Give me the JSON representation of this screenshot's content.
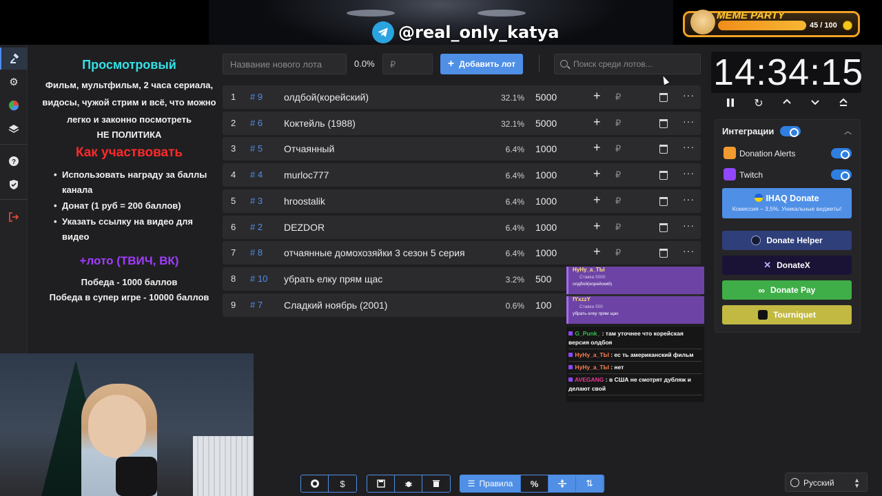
{
  "banner": {
    "handle": "@real_only_katya",
    "meme_title": "MEME PARTY",
    "meme_count": "45 / 100",
    "meme_progress": 0.45
  },
  "rail": {
    "items": [
      "auction-icon",
      "gear-icon",
      "stats-icon",
      "layers-icon",
      "help-icon",
      "shield-icon",
      "logout-icon"
    ]
  },
  "info": {
    "title": "Просмотровый",
    "description": "Фильм, мультфильм, 2 часа сериала, видосы, чужой стрим и всё, что можно легко и законно посмотреть",
    "no_politics": "НЕ ПОЛИТИКА",
    "how_title": "Как участвовать",
    "how_items": [
      "Использовать награду за баллы канала",
      "Донат (1 руб = 200 баллов)",
      "Указать ссылку на видео для видео"
    ],
    "loto": "+лото (ТВИЧ, ВК)",
    "win1": "Победа - 1000 баллов",
    "win2": "Победа в супер игре - 10000 баллов"
  },
  "controls": {
    "name_placeholder": "Название нового лота",
    "percent": "0.0%",
    "amount_placeholder": "₽",
    "add_label": "Добавить лот",
    "search_placeholder": "Поиск среди лотов..."
  },
  "lots": [
    {
      "index": "1",
      "id": "# 9",
      "name": "олдбой(корейский)",
      "percent": "32.1%",
      "amount": "5000"
    },
    {
      "index": "2",
      "id": "# 6",
      "name": "Коктейль (1988)",
      "percent": "32.1%",
      "amount": "5000"
    },
    {
      "index": "3",
      "id": "# 5",
      "name": "Отчаянный",
      "percent": "6.4%",
      "amount": "1000"
    },
    {
      "index": "4",
      "id": "# 4",
      "name": "murloc777",
      "percent": "6.4%",
      "amount": "1000"
    },
    {
      "index": "5",
      "id": "# 3",
      "name": "hroostalik",
      "percent": "6.4%",
      "amount": "1000"
    },
    {
      "index": "6",
      "id": "# 2",
      "name": "DEZDOR",
      "percent": "6.4%",
      "amount": "1000"
    },
    {
      "index": "7",
      "id": "# 8",
      "name": "отчаянные домохозяйки 3 сезон 5 серия",
      "percent": "6.4%",
      "amount": "1000"
    },
    {
      "index": "8",
      "id": "# 10",
      "name": "убрать елку прям щас",
      "percent": "3.2%",
      "amount": "500"
    },
    {
      "index": "9",
      "id": "# 7",
      "name": "Сладкий ноябрь (2001)",
      "percent": "0.6%",
      "amount": "100"
    }
  ],
  "lot_row_icons": {
    "plus": "+",
    "currency": "₽",
    "more": "···"
  },
  "donations": [
    {
      "user": "НуНу_а_ТЫ",
      "stake": "Ставка 5000",
      "lot": "олдбой(корейский)"
    },
    {
      "user": "fYxzzY",
      "stake": "Ставка 500",
      "lot": "убрать елку прям щас"
    }
  ],
  "chat": [
    {
      "user": "G_Punk_",
      "text": ": там уточнее что корейская версия олдбоя"
    },
    {
      "user": "НуНу_а_ТЫ",
      "text": ": ес ть американский фильм"
    },
    {
      "user": "НуНу_а_ТЫ",
      "text": ": нет"
    },
    {
      "user": "AVEGANG",
      "text": ": в США не смотрят дубляж и делают свой"
    }
  ],
  "timer": {
    "value": "14:34:15"
  },
  "integrations": {
    "title": "Интеграции",
    "providers": [
      "Donation Alerts",
      "Twitch"
    ],
    "ihaq_title": "IHAQ Donate",
    "ihaq_sub": "Комиссия – 3,5%. Уникальные виджеты!",
    "buttons": [
      "Donate Helper",
      "DonateX",
      "Donate Pay",
      "Tourniquet"
    ],
    "colors": {
      "donate_helper": "#2e3f7a",
      "donatex": "#1b1335",
      "donate_pay": "#3fae48",
      "tourniquet": "#c2b943"
    }
  },
  "toolbar": {
    "rules_label": "Правила",
    "percent_label": "%"
  },
  "language": {
    "value": "Русский"
  }
}
